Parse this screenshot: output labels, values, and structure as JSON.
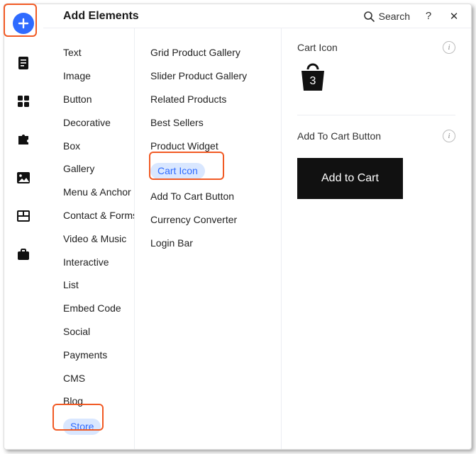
{
  "header": {
    "title": "Add Elements",
    "search_label": "Search",
    "help_label": "?",
    "close_label": "✕"
  },
  "rail": {
    "items": [
      {
        "name": "add",
        "interact": true
      },
      {
        "name": "page",
        "interact": true
      },
      {
        "name": "apps",
        "interact": true
      },
      {
        "name": "settings",
        "interact": true
      },
      {
        "name": "media",
        "interact": true
      },
      {
        "name": "video",
        "interact": true
      },
      {
        "name": "store",
        "interact": true
      }
    ]
  },
  "categories": [
    "Text",
    "Image",
    "Button",
    "Decorative",
    "Box",
    "Gallery",
    "Menu & Anchor",
    "Contact & Forms",
    "Video & Music",
    "Interactive",
    "List",
    "Embed Code",
    "Social",
    "Payments",
    "CMS",
    "Blog",
    "Store"
  ],
  "categories_selected_index": 16,
  "store_items": [
    "Grid Product Gallery",
    "Slider Product Gallery",
    "Related Products",
    "Best Sellers",
    "Product Widget",
    "Cart Icon",
    "Add To Cart Button",
    "Currency Converter",
    "Login Bar"
  ],
  "store_selected_index": 5,
  "preview": {
    "cart_icon_label": "Cart Icon",
    "cart_count": "3",
    "add_to_cart_label": "Add To Cart Button",
    "add_to_cart_button_text": "Add to Cart"
  }
}
